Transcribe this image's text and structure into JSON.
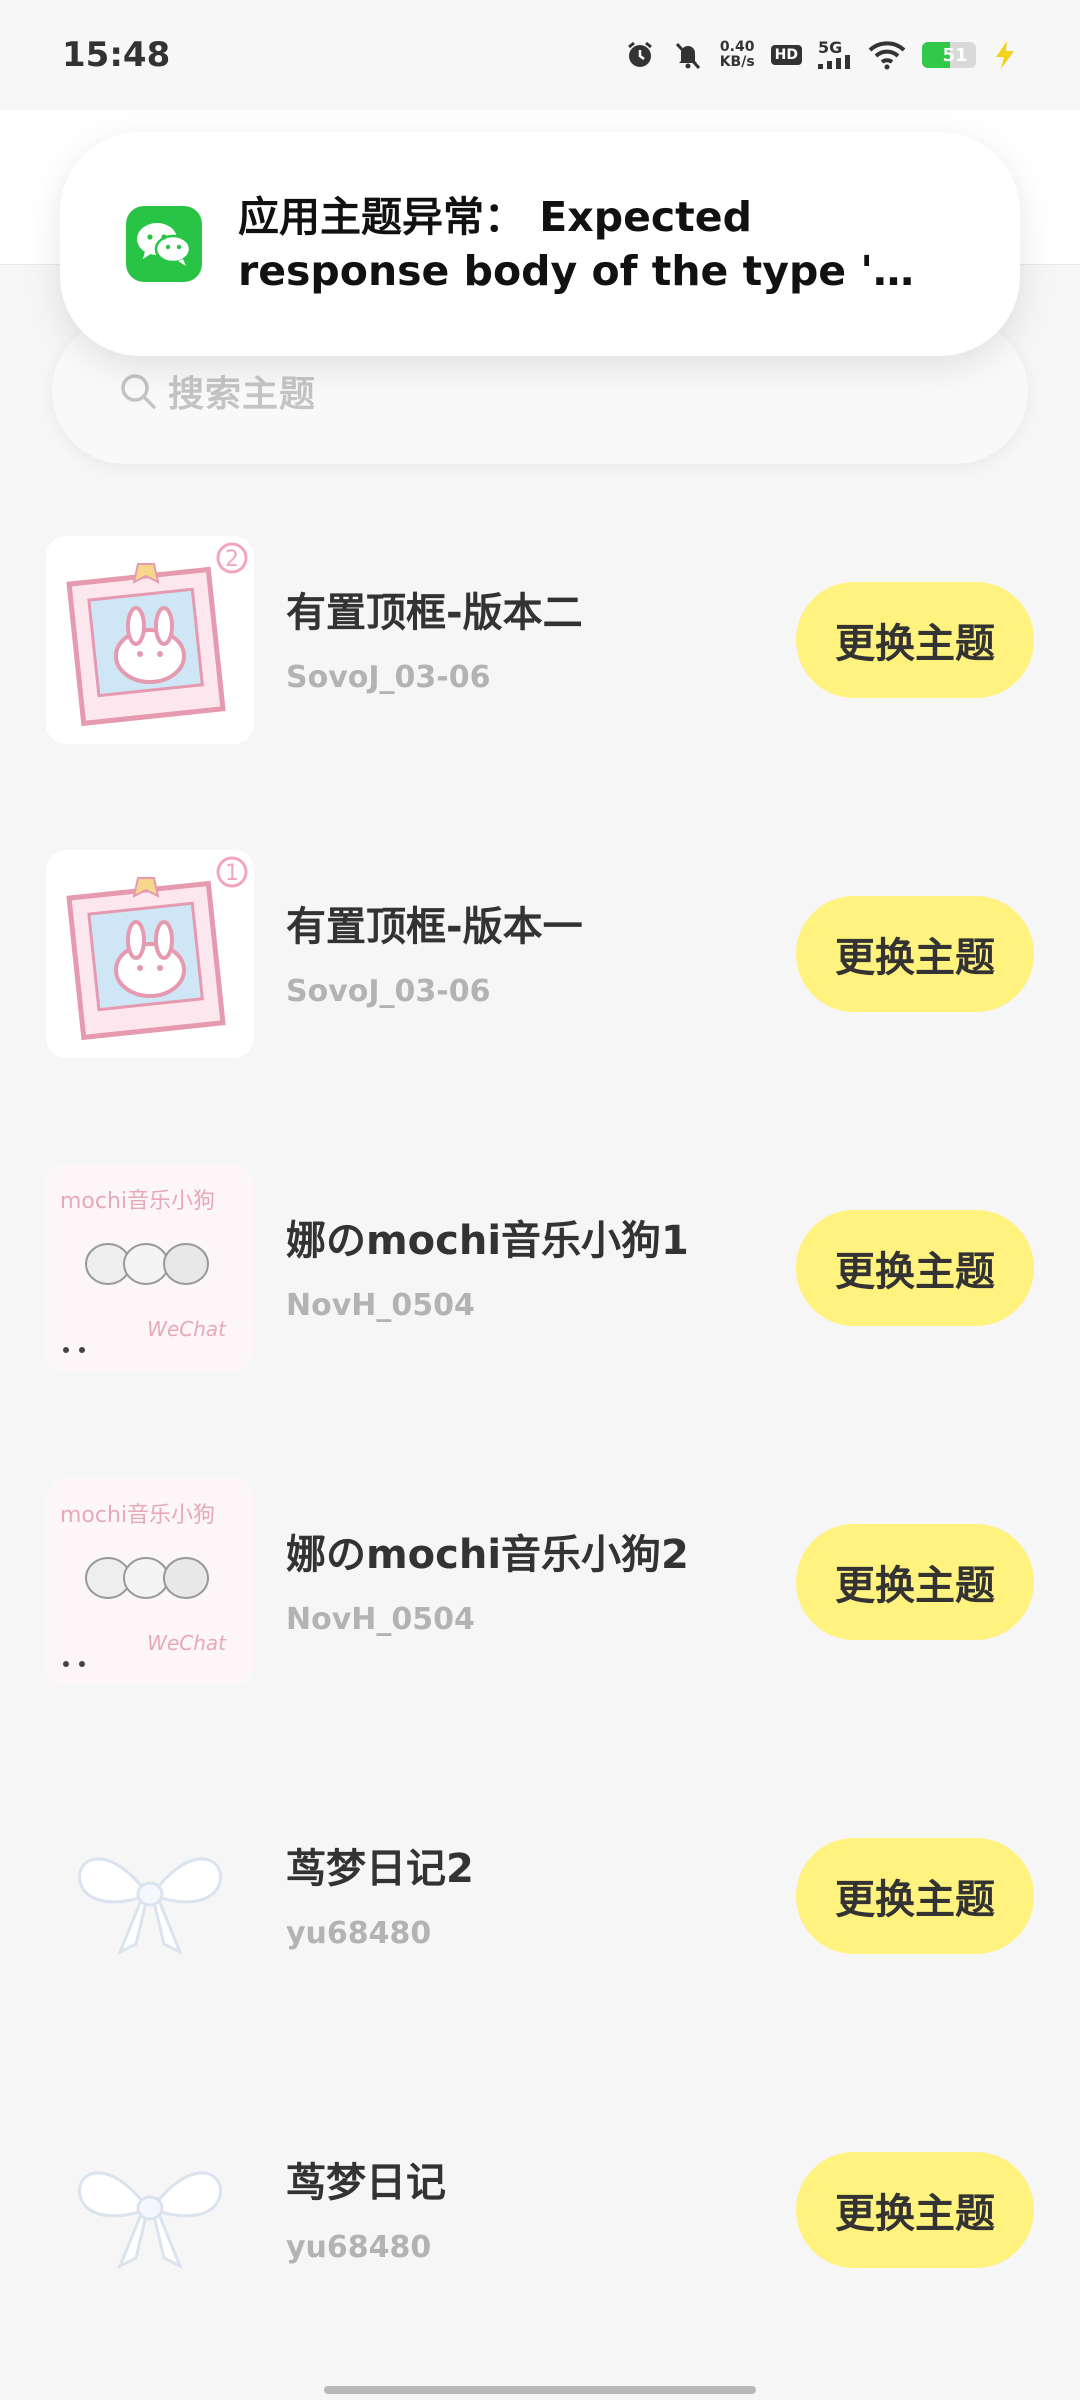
{
  "status_bar": {
    "time": "15:48",
    "net_speed_value": "0.40",
    "net_speed_unit": "KB/s",
    "hd_label": "HD",
    "network_label": "5G",
    "battery_level": "51",
    "icons": [
      "alarm-icon",
      "bell-muted-icon",
      "wifi-icon",
      "signal-icon",
      "charging-icon"
    ]
  },
  "notification": {
    "app_icon": "wechat-icon",
    "line1": "应用主题异常： Expected",
    "line2": "response body of the type 'class …"
  },
  "search": {
    "placeholder": "搜索主题"
  },
  "themes": [
    {
      "title": "有置顶框-版本二",
      "author": "SovoJ_03-06",
      "button": "更换主题",
      "thumb": "bunny-frame",
      "badge": "2"
    },
    {
      "title": "有置顶框-版本一",
      "author": "SovoJ_03-06",
      "button": "更换主题",
      "thumb": "bunny-frame",
      "badge": "1"
    },
    {
      "title": "娜のmochi音乐小狗1",
      "author": "NovH_0504",
      "button": "更换主题",
      "thumb": "mochi-dog",
      "thumb_text": "mochi音乐小狗",
      "thumb_sub": "WeChat"
    },
    {
      "title": "娜のmochi音乐小狗2",
      "author": "NovH_0504",
      "button": "更换主题",
      "thumb": "mochi-dog",
      "thumb_text": "mochi音乐小狗",
      "thumb_sub": "WeChat"
    },
    {
      "title": "茑梦日记2",
      "author": "yu68480",
      "button": "更换主题",
      "thumb": "white-bow"
    },
    {
      "title": "茑梦日记",
      "author": "yu68480",
      "button": "更换主题",
      "thumb": "white-bow"
    }
  ],
  "colors": {
    "accent_button": "#fff27e",
    "wechat_green": "#28c445",
    "battery_green": "#32c84a"
  }
}
